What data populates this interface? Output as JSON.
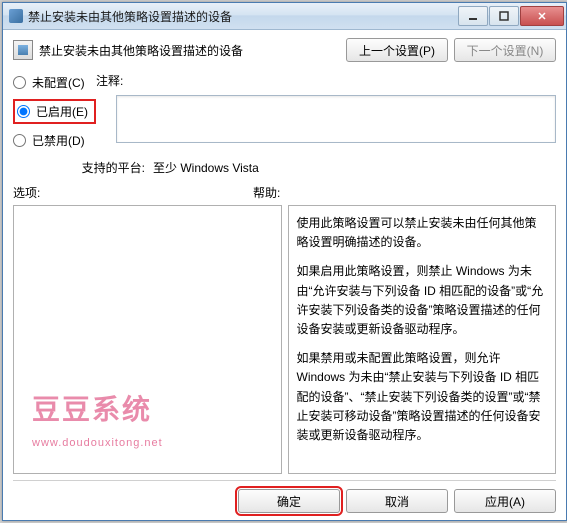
{
  "window": {
    "title": "禁止安装未由其他策略设置描述的设备"
  },
  "header": {
    "title": "禁止安装未由其他策略设置描述的设备",
    "prev": "上一个设置(P)",
    "next": "下一个设置(N)"
  },
  "radios": {
    "not_configured": "未配置(C)",
    "enabled": "已启用(E)",
    "disabled": "已禁用(D)"
  },
  "comment": {
    "label": "注释:"
  },
  "platform": {
    "label": "支持的平台:",
    "value": "至少 Windows Vista"
  },
  "labels": {
    "options": "选项:",
    "help": "帮助:"
  },
  "help": {
    "p1": "使用此策略设置可以禁止安装未由任何其他策略设置明确描述的设备。",
    "p2": "如果启用此策略设置，则禁止 Windows 为未由“允许安装与下列设备 ID 相匹配的设备”或“允许安装下列设备类的设备”策略设置描述的任何设备安装或更新设备驱动程序。",
    "p3": "如果禁用或未配置此策略设置，则允许 Windows 为未由“禁止安装与下列设备 ID 相匹配的设备”、“禁止安装下列设备类的设置”或“禁止安装可移动设备”策略设置描述的任何设备安装或更新设备驱动程序。"
  },
  "watermark": {
    "text": "豆豆系统",
    "url": "www.doudouxitong.net"
  },
  "footer": {
    "ok": "确定",
    "cancel": "取消",
    "apply": "应用(A)"
  }
}
